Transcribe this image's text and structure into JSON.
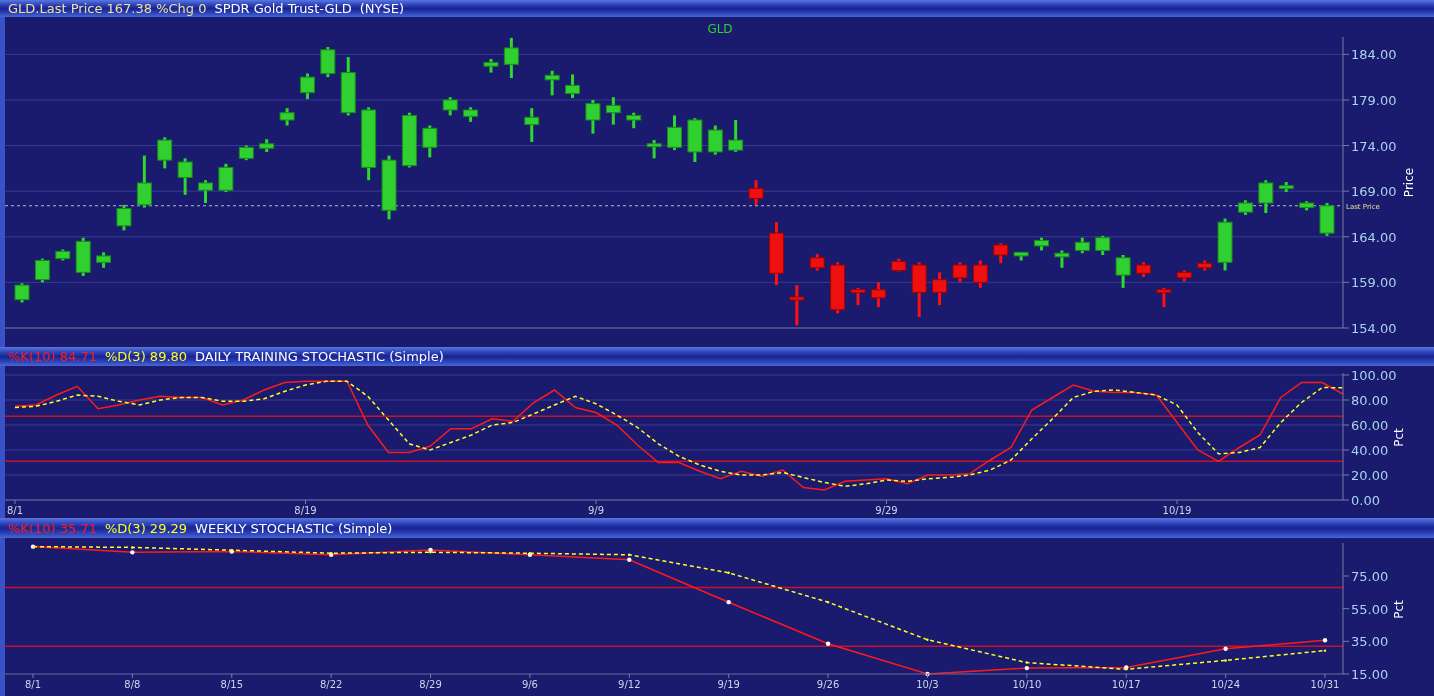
{
  "panels": [
    {
      "header": [
        {
          "text": "GLD.Last Price 167.38 %Chg 0",
          "color": "#f0e0a0"
        },
        {
          "text": "SPDR Gold Trust-GLD",
          "color": "#ffffff"
        },
        {
          "text": "(NYSE)",
          "color": "#ffffff"
        }
      ],
      "chart_data": {
        "type": "candlestick",
        "title": "GLD",
        "ylabel": "Price",
        "ylim": [
          154,
          185.9
        ],
        "grid": true,
        "categories": [
          null,
          null,
          null,
          null,
          null,
          null,
          null,
          null,
          null,
          null,
          null,
          null,
          null,
          null,
          null,
          null,
          null,
          null,
          null,
          null,
          null,
          null,
          null,
          null,
          null,
          null,
          null,
          null,
          null,
          null,
          null,
          null,
          null,
          null,
          null,
          null,
          null,
          null,
          null,
          null,
          null,
          null,
          null,
          null,
          null,
          null,
          null,
          null,
          null,
          null,
          null,
          null,
          null,
          null,
          null,
          null,
          null,
          null,
          null,
          null,
          null,
          null,
          null,
          null,
          null
        ],
        "yticks": [
          {
            "value": 154,
            "label": "154.00"
          },
          {
            "value": 159,
            "label": "159.00"
          },
          {
            "value": 164,
            "label": "164.00"
          },
          {
            "value": 169,
            "label": "169.00"
          },
          {
            "value": 174,
            "label": "174.00"
          },
          {
            "value": 179,
            "label": "179.00"
          },
          {
            "value": 184,
            "label": "184.00"
          }
        ],
        "ohlc": [
          [
            157.1,
            158.9,
            156.8,
            158.7
          ],
          [
            159.3,
            161.6,
            159.0,
            161.4
          ],
          [
            161.6,
            162.6,
            161.4,
            162.4
          ],
          [
            160.1,
            163.9,
            159.7,
            163.5
          ],
          [
            161.2,
            162.3,
            160.6,
            161.9
          ],
          [
            165.2,
            167.5,
            164.7,
            167.1
          ],
          [
            167.5,
            172.9,
            167.2,
            169.9
          ],
          [
            172.4,
            174.9,
            171.5,
            174.6
          ],
          [
            170.5,
            172.6,
            168.6,
            172.2
          ],
          [
            169.1,
            170.2,
            167.7,
            169.9
          ],
          [
            169.1,
            172.0,
            168.9,
            171.6
          ],
          [
            172.6,
            174.0,
            172.4,
            173.8
          ],
          [
            173.7,
            174.7,
            173.3,
            174.2
          ],
          [
            176.8,
            178.1,
            176.2,
            177.6
          ],
          [
            179.8,
            181.9,
            179.1,
            181.5
          ],
          [
            181.9,
            184.8,
            181.5,
            184.5
          ],
          [
            177.6,
            183.7,
            177.3,
            182.0
          ],
          [
            171.6,
            178.2,
            170.2,
            177.9
          ],
          [
            166.9,
            172.9,
            165.9,
            172.4
          ],
          [
            171.8,
            177.6,
            171.6,
            177.3
          ],
          [
            173.8,
            176.2,
            172.7,
            175.9
          ],
          [
            177.9,
            179.3,
            177.3,
            179.0
          ],
          [
            177.2,
            178.2,
            176.6,
            177.9
          ],
          [
            182.7,
            183.5,
            182.0,
            183.1
          ],
          [
            182.9,
            185.8,
            181.4,
            184.7
          ],
          [
            176.3,
            178.1,
            174.4,
            177.1
          ],
          [
            181.2,
            182.2,
            179.5,
            181.7
          ],
          [
            179.7,
            181.8,
            179.2,
            180.6
          ],
          [
            176.8,
            179.0,
            175.3,
            178.6
          ],
          [
            177.6,
            179.3,
            176.3,
            178.4
          ],
          [
            176.8,
            177.6,
            175.9,
            177.3
          ],
          [
            174.0,
            174.6,
            172.6,
            174.2
          ],
          [
            173.8,
            177.3,
            173.5,
            176.0
          ],
          [
            173.3,
            177.0,
            172.2,
            176.8
          ],
          [
            173.3,
            176.2,
            173.0,
            175.7
          ],
          [
            173.5,
            176.8,
            173.3,
            174.6
          ],
          [
            169.3,
            170.2,
            167.5,
            168.2
          ],
          [
            164.4,
            165.6,
            158.7,
            160.0
          ],
          [
            157.4,
            158.7,
            154.3,
            157.2
          ],
          [
            161.7,
            162.1,
            160.3,
            160.6
          ],
          [
            160.9,
            161.2,
            155.6,
            156.0
          ],
          [
            158.2,
            158.4,
            156.5,
            157.9
          ],
          [
            158.2,
            159.0,
            156.3,
            157.3
          ],
          [
            161.3,
            161.6,
            160.2,
            160.3
          ],
          [
            160.9,
            161.2,
            155.2,
            157.9
          ],
          [
            159.3,
            160.1,
            156.5,
            157.9
          ],
          [
            160.9,
            161.2,
            159.0,
            159.5
          ],
          [
            160.9,
            161.4,
            158.4,
            159.0
          ],
          [
            163.1,
            163.3,
            161.1,
            162.0
          ],
          [
            161.9,
            162.3,
            161.4,
            162.3
          ],
          [
            163.0,
            163.9,
            162.5,
            163.6
          ],
          [
            161.8,
            162.5,
            160.6,
            162.2
          ],
          [
            162.5,
            163.9,
            162.2,
            163.4
          ],
          [
            162.5,
            164.1,
            162.0,
            163.9
          ],
          [
            159.8,
            162.0,
            158.4,
            161.7
          ],
          [
            160.9,
            161.2,
            159.6,
            160.0
          ],
          [
            158.2,
            158.4,
            156.3,
            157.9
          ],
          [
            160.1,
            160.3,
            159.1,
            159.5
          ],
          [
            161.1,
            161.4,
            160.3,
            160.6
          ],
          [
            161.2,
            166.0,
            160.3,
            165.6
          ],
          [
            166.7,
            168.0,
            166.4,
            167.7
          ],
          [
            167.7,
            170.2,
            166.6,
            169.9
          ],
          [
            169.3,
            170.0,
            168.9,
            169.6
          ],
          [
            167.2,
            167.9,
            166.9,
            167.7
          ],
          [
            164.4,
            167.7,
            164.1,
            167.4
          ]
        ],
        "ref_lines": [
          {
            "axis": "y",
            "value": 167.4,
            "label": "Last Price"
          }
        ]
      }
    },
    {
      "legend_values": [
        "84.71",
        "89.80"
      ],
      "title": "DAILY TRAINING STOCHASTIC (Simple)",
      "chart_data": {
        "type": "line",
        "ylabel": "Pct",
        "ylim": [
          0,
          100
        ],
        "grid": true,
        "categories": [
          "8/1",
          null,
          null,
          null,
          null,
          null,
          null,
          null,
          null,
          null,
          null,
          null,
          null,
          null,
          "8/19",
          null,
          null,
          null,
          null,
          null,
          null,
          null,
          null,
          null,
          null,
          null,
          null,
          null,
          "9/9",
          null,
          null,
          null,
          null,
          null,
          null,
          null,
          null,
          null,
          null,
          null,
          null,
          null,
          "9/29",
          null,
          null,
          null,
          null,
          null,
          null,
          null,
          null,
          null,
          null,
          null,
          null,
          null,
          "10/19",
          null,
          null,
          null,
          null,
          null,
          null,
          null,
          null
        ],
        "yticks": [
          {
            "value": 0,
            "label": "0.00"
          },
          {
            "value": 20,
            "label": "20.00"
          },
          {
            "value": 40,
            "label": "40.00"
          },
          {
            "value": 60,
            "label": "60.00"
          },
          {
            "value": 80,
            "label": "80.00"
          },
          {
            "value": 100,
            "label": "100.00"
          }
        ],
        "series": [
          {
            "name": "%K(10)",
            "color": "#ff1a1a",
            "line_style": "solid",
            "values": [
              75,
              76,
              84,
              91,
              73,
              76,
              80,
              83,
              82,
              82,
              76,
              80,
              88,
              94,
              95,
              95,
              95,
              60,
              38,
              38,
              43,
              57,
              57,
              65,
              63,
              78,
              88,
              74,
              70,
              60,
              44,
              30,
              30,
              23,
              17,
              23,
              19,
              24,
              10,
              8,
              15,
              16,
              17,
              13,
              20,
              20,
              21,
              32,
              42,
              72,
              82,
              92,
              87,
              86,
              86,
              84,
              62,
              40,
              31,
              42,
              52,
              82,
              94,
              94,
              84.7
            ]
          },
          {
            "name": "%D(3)",
            "color": "#ffff20",
            "line_style": "dashed",
            "values": [
              74,
              75,
              79,
              84,
              83,
              79,
              76,
              80,
              82,
              82,
              79,
              79,
              81,
              87,
              92,
              95,
              95,
              83,
              64,
              45,
              40,
              46,
              52,
              60,
              62,
              69,
              76,
              83,
              77,
              68,
              58,
              45,
              35,
              28,
              23,
              20,
              20,
              22,
              18,
              14,
              11,
              13,
              16,
              15,
              17,
              18,
              20,
              24,
              32,
              49,
              65,
              82,
              87,
              88,
              86,
              84,
              76,
              54,
              37,
              38,
              42,
              62,
              78,
              90,
              89.8
            ]
          }
        ],
        "ref_lines": [
          {
            "axis": "y",
            "value": 67
          },
          {
            "axis": "y",
            "value": 31
          }
        ]
      }
    },
    {
      "legend_values": [
        "35.71",
        "29.29"
      ],
      "title": "WEEKLY STOCHASTIC (Simple)",
      "chart_data": {
        "type": "line",
        "ylabel": "Pct",
        "ylim": [
          15,
          94
        ],
        "categories": [
          "8/1",
          "8/8",
          "8/15",
          "8/22",
          "8/29",
          "9/6",
          "9/12",
          "9/19",
          "9/26",
          "10/3",
          "10/10",
          "10/17",
          "10/24",
          "10/31"
        ],
        "yticks": [
          {
            "value": 15,
            "label": "15.00"
          },
          {
            "value": 35,
            "label": "35.00"
          },
          {
            "value": 55,
            "label": "55.00"
          },
          {
            "value": 75,
            "label": "75.00"
          }
        ],
        "series": [
          {
            "name": "%K(10)",
            "color": "#ff1a1a",
            "line_style": "solid",
            "values": [
              93,
              89.5,
              90,
              88,
              91,
              88,
              85,
              59,
              33.5,
              15,
              18.6,
              19,
              30.5,
              35.7
            ]
          },
          {
            "name": "%D(3)",
            "color": "#ffff20",
            "line_style": "dashed",
            "values": [
              93,
              92.5,
              90.8,
              89,
              89.5,
              89,
              88,
              77,
              59,
              36,
              22,
              17.9,
              23.3,
              29.3
            ]
          }
        ],
        "ref_lines": [
          {
            "axis": "y",
            "value": 68
          },
          {
            "axis": "y",
            "value": 32
          }
        ]
      }
    }
  ]
}
